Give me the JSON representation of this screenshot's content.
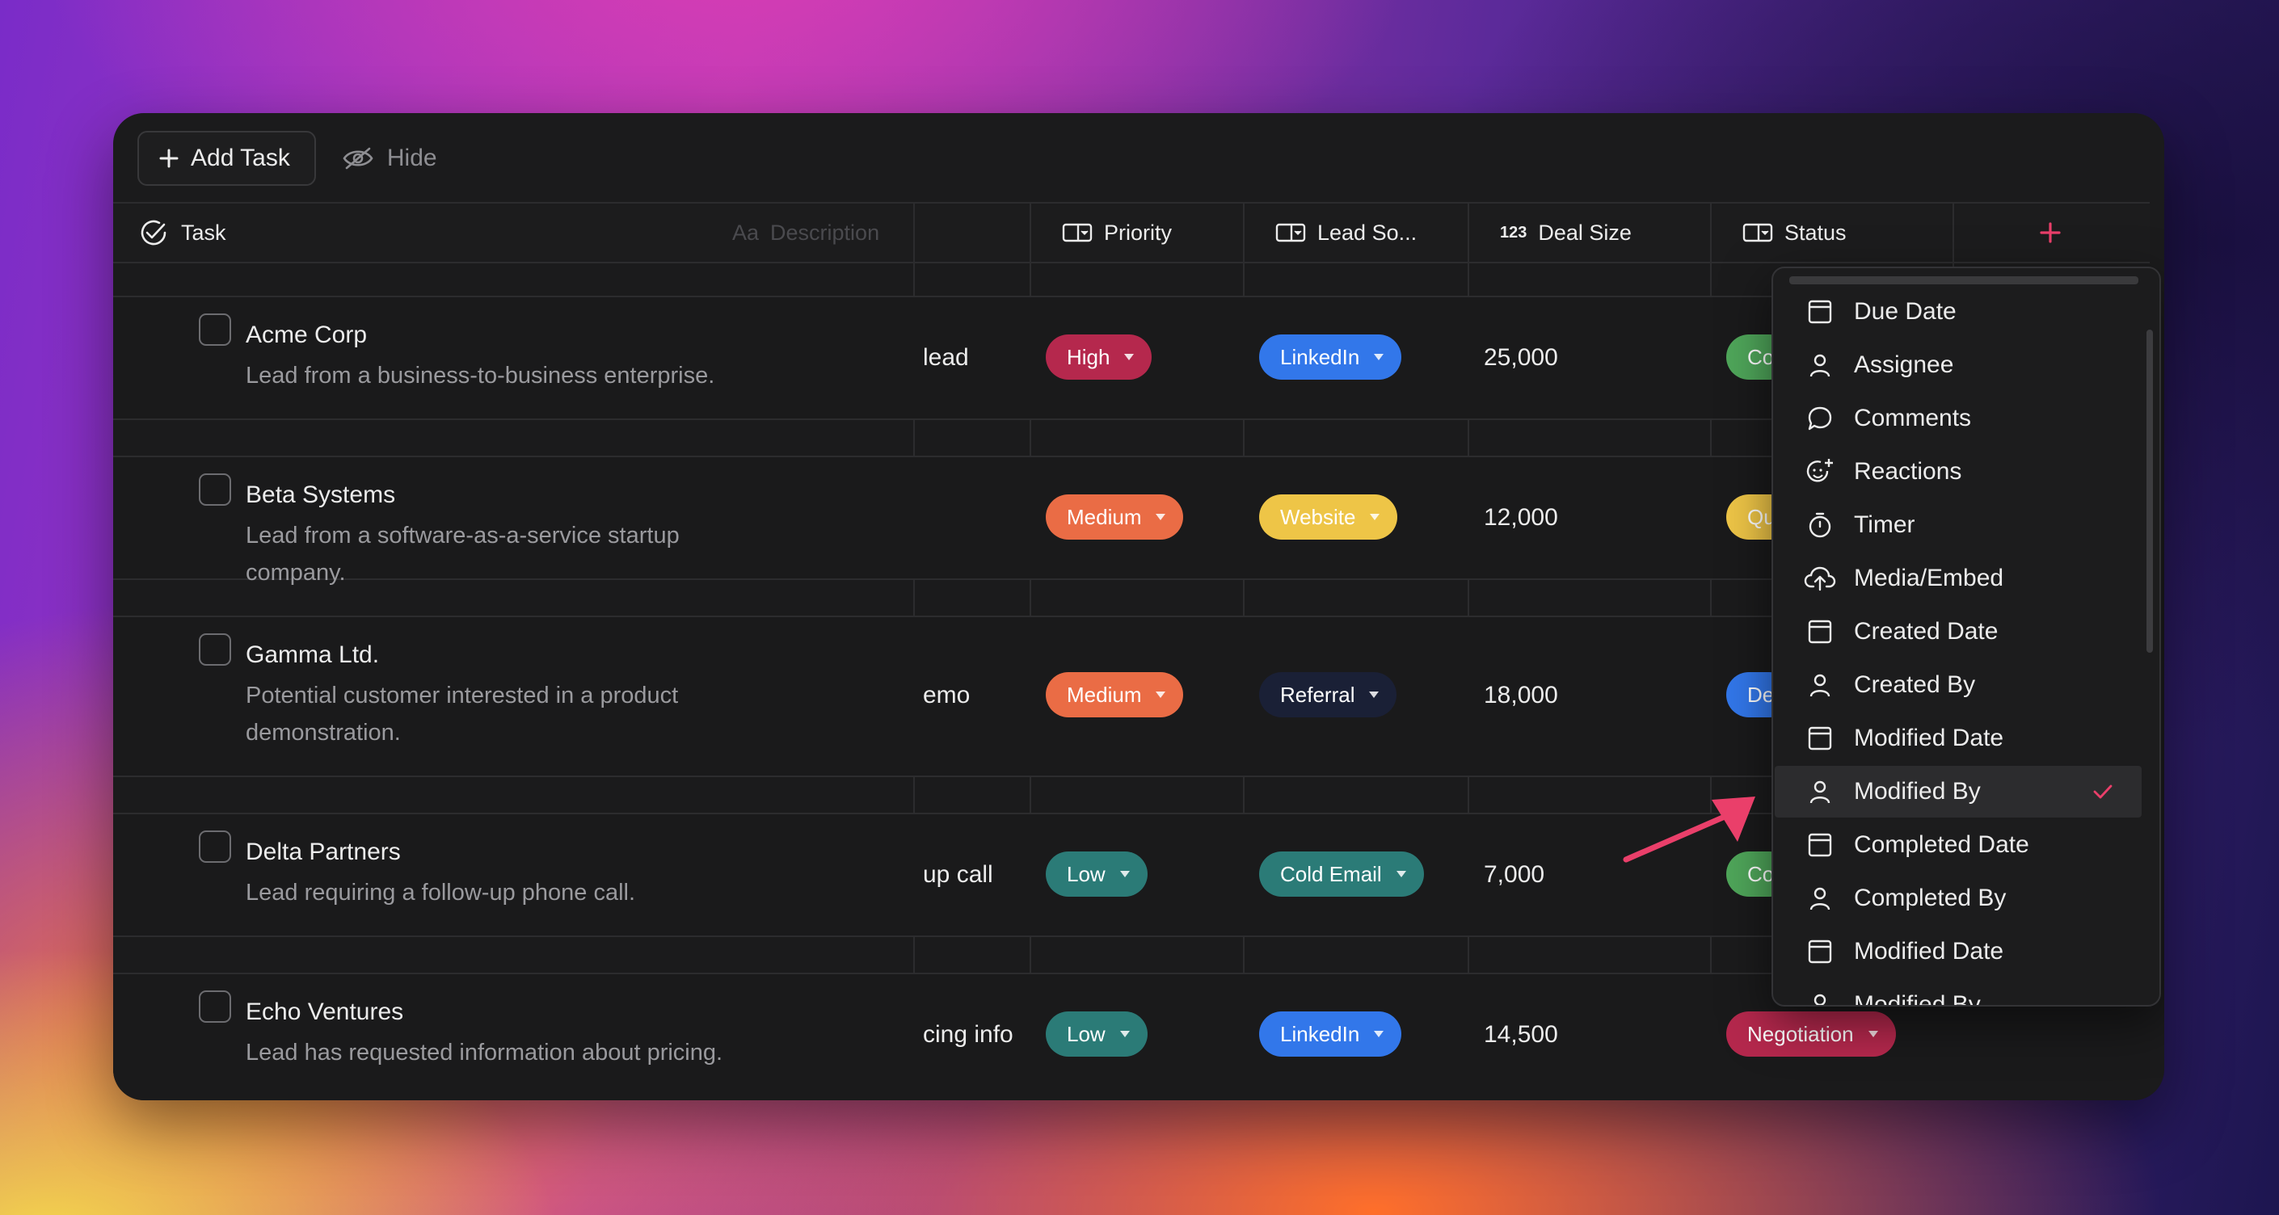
{
  "toolbar": {
    "add_label": "Add Task",
    "hide_label": "Hide"
  },
  "columns": {
    "task": "Task",
    "description": "Description",
    "priority": "Priority",
    "lead_source": "Lead So...",
    "deal_size": "Deal Size",
    "status": "Status"
  },
  "rows": [
    {
      "title": "Acme Corp",
      "desc": "Lead from a business-to-business enterprise.",
      "desc_frag": "lead",
      "priority": "High",
      "lead_source": "LinkedIn",
      "deal": "25,000",
      "status": "Co"
    },
    {
      "title": "Beta Systems",
      "desc": "Lead from a software-as-a-service startup company.",
      "desc_frag": "",
      "priority": "Medium",
      "lead_source": "Website",
      "deal": "12,000",
      "status": "Qu"
    },
    {
      "title": "Gamma Ltd.",
      "desc": "Potential customer interested in a product demonstration.",
      "desc_frag": "emo",
      "priority": "Medium",
      "lead_source": "Referral",
      "deal": "18,000",
      "status": "De"
    },
    {
      "title": "Delta Partners",
      "desc": "Lead requiring a follow-up phone call.",
      "desc_frag": "up call",
      "priority": "Low",
      "lead_source": "Cold Email",
      "deal": "7,000",
      "status": "Co"
    },
    {
      "title": "Echo Ventures",
      "desc": "Lead has requested information about pricing.",
      "desc_frag": "cing info",
      "priority": "Low",
      "lead_source": "LinkedIn",
      "deal": "14,500",
      "status": "Negotiation"
    }
  ],
  "menu": {
    "items": [
      {
        "label": "Due Date",
        "icon": "calendar-icon"
      },
      {
        "label": "Assignee",
        "icon": "person-icon"
      },
      {
        "label": "Comments",
        "icon": "comment-icon"
      },
      {
        "label": "Reactions",
        "icon": "smile-plus-icon"
      },
      {
        "label": "Timer",
        "icon": "timer-icon"
      },
      {
        "label": "Media/Embed",
        "icon": "cloud-upload-icon"
      },
      {
        "label": "Created Date",
        "icon": "calendar-icon"
      },
      {
        "label": "Created By",
        "icon": "person-icon"
      },
      {
        "label": "Modified Date",
        "icon": "calendar-icon"
      },
      {
        "label": "Modified By",
        "icon": "person-icon",
        "selected": true
      },
      {
        "label": "Completed Date",
        "icon": "calendar-icon"
      },
      {
        "label": "Completed By",
        "icon": "person-icon"
      },
      {
        "label": "Modified Date",
        "icon": "calendar-icon"
      },
      {
        "label": "Modified By",
        "icon": "person-icon"
      }
    ]
  },
  "colors": {
    "high": "#b5284d",
    "medium": "#ea6c45",
    "low": "#2b7b77",
    "linkedin": "#3277ea",
    "website": "#eec547",
    "referral": "#1a2036",
    "cold_email": "#2b7b77",
    "status_green": "#4fa65a",
    "status_yellow": "#eec547",
    "status_blue": "#3277ea",
    "negotiation": "#b5284d",
    "accent": "#ea3f6a"
  }
}
